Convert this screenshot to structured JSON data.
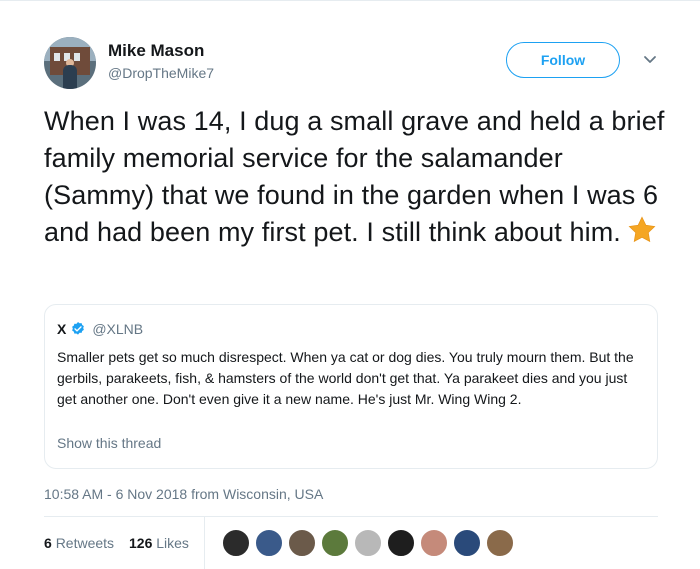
{
  "tweet": {
    "author_name": "Mike Mason",
    "author_handle": "@DropTheMike7",
    "follow_label": "Follow",
    "text": "When I was 14, I dug a small grave and held a brief family memorial service for the salamander (Sammy) that we found in the garden when I was 6 and had been my first pet. I still think about him.",
    "emoji_icon": "star-emoji",
    "timestamp": "10:58 AM - 6 Nov 2018 from Wisconsin, USA"
  },
  "quote": {
    "name": "X",
    "handle": "@XLNB",
    "verified_icon": "verified-badge-icon",
    "text": "Smaller pets get so much disrespect. When ya cat or dog dies. You truly mourn them. But the gerbils, parakeets, fish, & hamsters of the world don't get that. Ya parakeet dies and you just get another one. Don't even give it a new name. He's just Mr. Wing Wing 2.",
    "thread_link": "Show this thread"
  },
  "stats": {
    "retweets_count": "6",
    "retweets_label": "Retweets",
    "likes_count": "126",
    "likes_label": "Likes"
  },
  "likers": [
    {
      "color": "#2b2b2b"
    },
    {
      "color": "#3a5a8a"
    },
    {
      "color": "#6b5a4a"
    },
    {
      "color": "#5c7a3c"
    },
    {
      "color": "#b8b8b8"
    },
    {
      "color": "#1e1e1e"
    },
    {
      "color": "#c58a7a"
    },
    {
      "color": "#2a4a7a"
    },
    {
      "color": "#8a6a4a"
    }
  ],
  "colors": {
    "accent": "#1da1f2",
    "secondary_text": "#657786",
    "primary_text": "#14171a",
    "star": "#f5a623"
  }
}
